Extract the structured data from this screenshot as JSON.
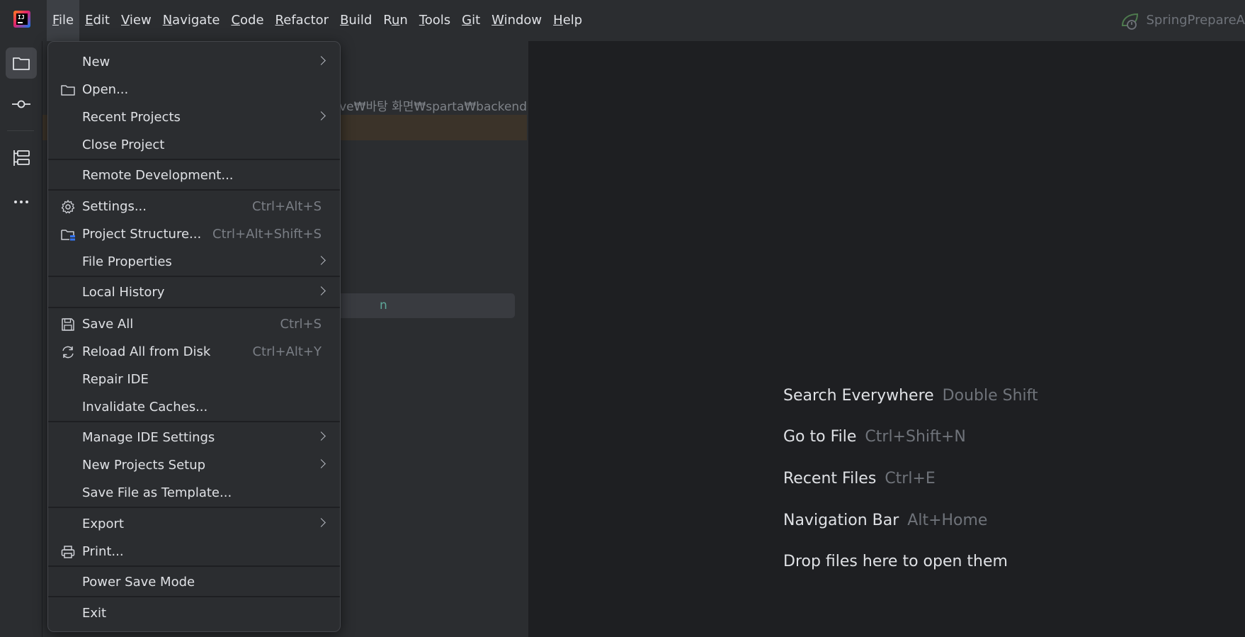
{
  "menubar": {
    "items": [
      {
        "label": "File",
        "mnemonic": "F",
        "rest": "ile"
      },
      {
        "label": "Edit",
        "mnemonic": "E",
        "rest": "dit"
      },
      {
        "label": "View",
        "mnemonic": "V",
        "rest": "iew"
      },
      {
        "label": "Navigate",
        "mnemonic": "N",
        "rest": "avigate"
      },
      {
        "label": "Code",
        "mnemonic": "C",
        "rest": "ode"
      },
      {
        "label": "Refactor",
        "mnemonic": "R",
        "rest": "efactor"
      },
      {
        "label": "Build",
        "mnemonic": "B",
        "rest": "uild"
      },
      {
        "label": "Run",
        "mnemonic": "",
        "pre": "R",
        "mn2": "u",
        "rest": "n"
      },
      {
        "label": "Tools",
        "mnemonic": "T",
        "rest": "ools"
      },
      {
        "label": "Git",
        "mnemonic": "G",
        "rest": "it"
      },
      {
        "label": "Window",
        "mnemonic": "W",
        "rest": "indow"
      },
      {
        "label": "Help",
        "mnemonic": "H",
        "rest": "elp"
      }
    ],
    "project_name": "SpringPrepareA"
  },
  "project_panel": {
    "path_text": "rive₩바탕 화면₩sparta₩backend",
    "highlight_fragment": "n"
  },
  "file_menu": {
    "new": "New",
    "open": "Open...",
    "recent_projects": "Recent Projects",
    "close_project": "Close Project",
    "remote_development": "Remote Development...",
    "settings": "Settings...",
    "settings_shortcut": "Ctrl+Alt+S",
    "project_structure": "Project Structure...",
    "project_structure_shortcut": "Ctrl+Alt+Shift+S",
    "file_properties": "File Properties",
    "local_history": "Local History",
    "save_all": "Save All",
    "save_all_shortcut": "Ctrl+S",
    "reload_all": "Reload All from Disk",
    "reload_all_shortcut": "Ctrl+Alt+Y",
    "repair_ide": "Repair IDE",
    "invalidate_caches": "Invalidate Caches...",
    "manage_ide_settings": "Manage IDE Settings",
    "new_projects_setup": "New Projects Setup",
    "save_file_as_template": "Save File as Template...",
    "export": "Export",
    "print": "Print...",
    "power_save_mode": "Power Save Mode",
    "exit": "Exit"
  },
  "editor_hints": [
    {
      "action": "Search Everywhere",
      "shortcut": "Double Shift"
    },
    {
      "action": "Go to File",
      "shortcut": "Ctrl+Shift+N"
    },
    {
      "action": "Recent Files",
      "shortcut": "Ctrl+E"
    },
    {
      "action": "Navigation Bar",
      "shortcut": "Alt+Home"
    },
    {
      "action": "Drop files here to open them",
      "shortcut": ""
    }
  ],
  "icons": {
    "app": "intellij-logo-icon",
    "project_tool": "folder-icon",
    "commit_tool": "commit-icon",
    "structure_tool": "structure-icon",
    "more_tools": "more-icon"
  },
  "colors": {
    "background": "#2b2d30",
    "editor": "#1e1f22",
    "menu_active": "#3d4045",
    "shortcut_text": "#7a7e85",
    "accent_blue": "#3574f0"
  }
}
